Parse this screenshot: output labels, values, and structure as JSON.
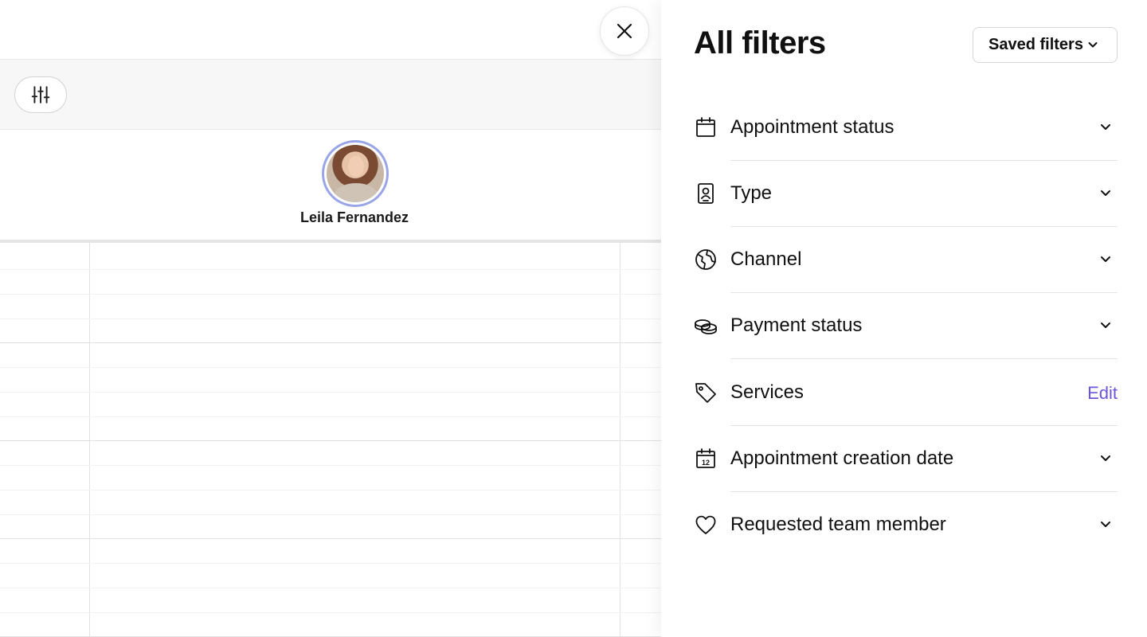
{
  "calendar": {
    "staff_name": "Leila Fernandez"
  },
  "panel": {
    "title": "All filters",
    "saved_filters_label": "Saved filters",
    "filters": [
      {
        "label": "Appointment status",
        "icon": "calendar-icon",
        "action": "expand"
      },
      {
        "label": "Type",
        "icon": "id-badge-icon",
        "action": "expand"
      },
      {
        "label": "Channel",
        "icon": "globe-icon",
        "action": "expand"
      },
      {
        "label": "Payment status",
        "icon": "coins-icon",
        "action": "expand"
      },
      {
        "label": "Services",
        "icon": "tag-icon",
        "action": "edit",
        "action_label": "Edit"
      },
      {
        "label": "Appointment creation date",
        "icon": "calendar-date-icon",
        "action": "expand"
      },
      {
        "label": "Requested team member",
        "icon": "heart-icon",
        "action": "expand"
      }
    ]
  },
  "colors": {
    "accent": "#6b55d9",
    "avatar_ring": "#9aa5e8",
    "text": "#101010"
  }
}
